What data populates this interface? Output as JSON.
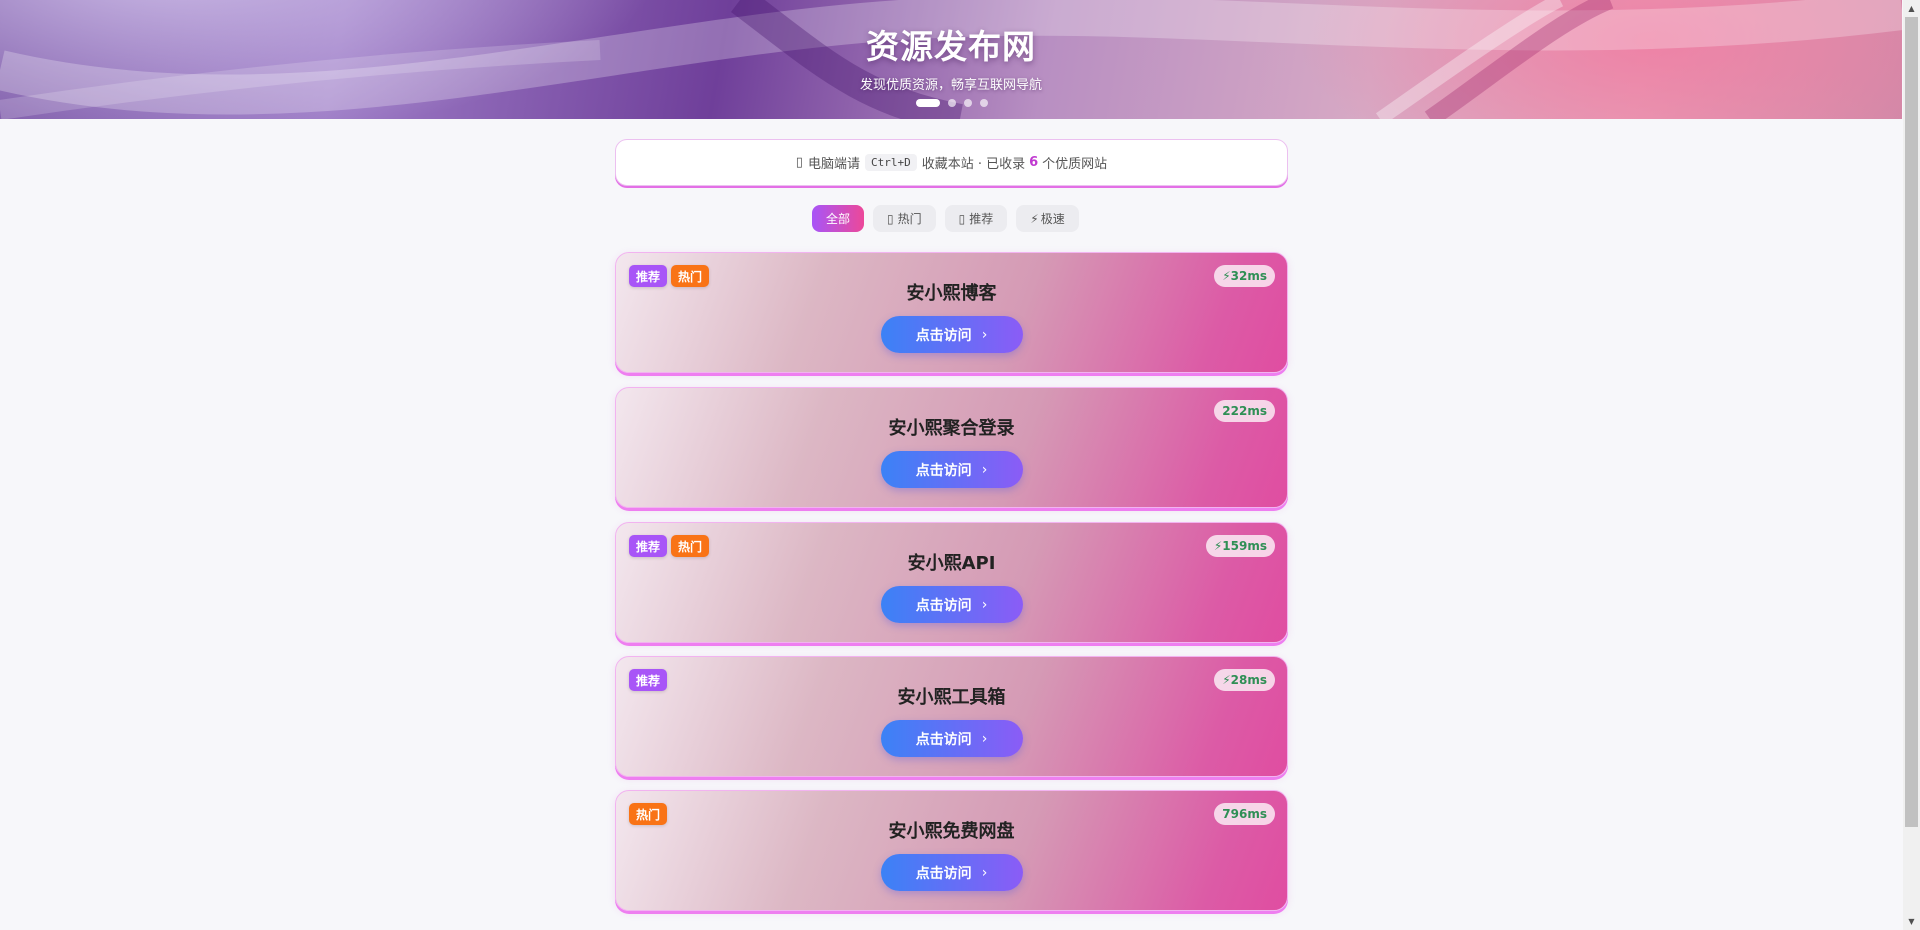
{
  "hero": {
    "title": "资源发布网",
    "subtitle": "发现优质资源，畅享互联网导航",
    "slides": 4,
    "active_slide": 1
  },
  "notice": {
    "icon": "computer-icon",
    "prefix": "电脑端请",
    "shortcut": "Ctrl+D",
    "middle": "收藏本站 · 已收录",
    "count": "6",
    "suffix": "个优质网站"
  },
  "tabs": [
    {
      "label": "全部",
      "icon": ""
    },
    {
      "label": "热门",
      "icon": "fire-icon"
    },
    {
      "label": "推荐",
      "icon": "thumbs-up-icon"
    },
    {
      "label": "极速",
      "icon": "lightning-icon",
      "glyph": "⚡"
    }
  ],
  "badge_labels": {
    "recommend": "推荐",
    "hot": "热门"
  },
  "cards": [
    {
      "title": "安小熙博客",
      "speed": "32ms",
      "lightning": true,
      "badges": [
        "推荐",
        "热门"
      ],
      "button": "点击访问"
    },
    {
      "title": "安小熙聚合登录",
      "speed": "222ms",
      "lightning": false,
      "badges": [],
      "button": "点击访问"
    },
    {
      "title": "安小熙API",
      "speed": "159ms",
      "lightning": true,
      "badges": [
        "推荐",
        "热门"
      ],
      "button": "点击访问"
    },
    {
      "title": "安小熙工具箱",
      "speed": "28ms",
      "lightning": true,
      "badges": [
        "推荐"
      ],
      "button": "点击访问"
    },
    {
      "title": "安小熙免费网盘",
      "speed": "796ms",
      "lightning": false,
      "badges": [
        "热门"
      ],
      "button": "点击访问"
    }
  ],
  "colors": {
    "accent_gradient_start": "#a855f7",
    "accent_gradient_end": "#ec4899",
    "button_start": "#3b82f6",
    "button_end": "#8b5cf6",
    "speed_text": "#2f8f55",
    "badge_recommend": "#a855f7",
    "badge_hot": "#f97316"
  }
}
